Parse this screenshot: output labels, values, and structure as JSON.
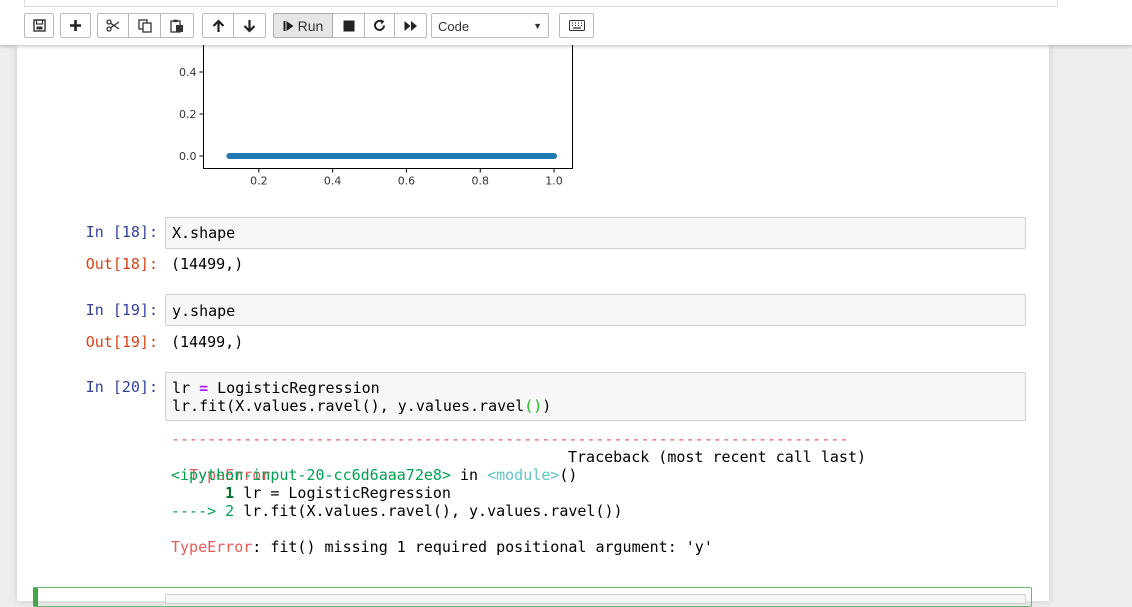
{
  "toolbar": {
    "buttons": [
      {
        "name": "save",
        "icon": "save-icon"
      },
      {
        "name": "insert-cell",
        "icon": "plus-icon"
      },
      {
        "name": "cut",
        "icon": "scissors-icon"
      },
      {
        "name": "copy",
        "icon": "copy-icon"
      },
      {
        "name": "paste",
        "icon": "paste-icon"
      },
      {
        "name": "move-up",
        "icon": "arrow-up-icon"
      },
      {
        "name": "move-down",
        "icon": "arrow-down-icon"
      },
      {
        "name": "run",
        "icon": "step-forward-icon"
      },
      {
        "name": "interrupt",
        "icon": "stop-icon"
      },
      {
        "name": "restart",
        "icon": "refresh-icon"
      },
      {
        "name": "restart-run-all",
        "icon": "fast-forward-icon"
      },
      {
        "name": "command-palette",
        "icon": "keyboard-icon"
      }
    ],
    "run_label": "Run",
    "cell_type": "Code"
  },
  "plot": {
    "y_ticks": [
      "0.4",
      "0.2",
      "0.0"
    ],
    "x_ticks": [
      "0.2",
      "0.4",
      "0.6",
      "0.8",
      "1.0"
    ],
    "line_color": "#1f77b4"
  },
  "chart_data": {
    "type": "line",
    "x": [
      0.12,
      1.0
    ],
    "y": [
      0.0,
      0.0
    ],
    "xlim": [
      0.05,
      1.05
    ],
    "x_ticks": [
      0.2,
      0.4,
      0.6,
      0.8,
      1.0
    ],
    "y_ticks": [
      0.0,
      0.2,
      0.4
    ]
  },
  "cells": [
    {
      "in_prompt": "In [18]:",
      "code": "X.shape",
      "out_prompt": "Out[18]:",
      "output": "(14499,)"
    },
    {
      "in_prompt": "In [19]:",
      "code": "y.shape",
      "out_prompt": "Out[19]:",
      "output": "(14499,)"
    },
    {
      "in_prompt": "In [20]:",
      "code_line1": {
        "a": "lr ",
        "op": "=",
        "b": " LogisticRegression"
      },
      "code_line2": {
        "a": "lr.fit(X.values.ravel(), y.values.ravel",
        "paren": "()",
        "b": ")"
      }
    }
  ],
  "traceback": {
    "dashes": "---------------------------------------------------------------------------",
    "error_type": "TypeError",
    "header_right": "Traceback (most recent call last)",
    "location": "<ipython-input-20-cc6d6aaa72e8>",
    "in_word": " in ",
    "module": "<module>",
    "module_paren": "()",
    "line1_num": "      1",
    "line1_code": " lr = LogisticRegression",
    "line2_arrow": "----> 2",
    "line2_code": " lr.fit(X.values.ravel(), y.values.ravel())",
    "error_label": "TypeError",
    "error_message": ": fit() missing 1 required positional argument: 'y'"
  },
  "colors": {
    "in_prompt": "#303f9f",
    "out_prompt": "#d84315",
    "selected_cell": "#66bb6a"
  }
}
